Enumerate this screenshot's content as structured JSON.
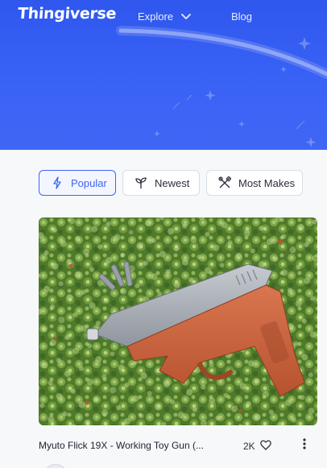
{
  "header": {
    "logo_text": "Thingiverse",
    "nav": {
      "explore_label": "Explore",
      "blog_label": "Blog"
    }
  },
  "tabs": [
    {
      "label": "Popular",
      "icon": "lightning-icon",
      "active": true
    },
    {
      "label": "Newest",
      "icon": "sprout-icon",
      "active": false
    },
    {
      "label": "Most Makes",
      "icon": "tools-icon",
      "active": false
    }
  ],
  "card": {
    "title": "Myuto Flick 19X - Working Toy Gun (...",
    "likes": "2K",
    "image_alt": "orange and gray 3D printed toy pistol on green succulents"
  },
  "colors": {
    "hero_blue": "#3a63f6",
    "accent": "#3b63f5"
  }
}
